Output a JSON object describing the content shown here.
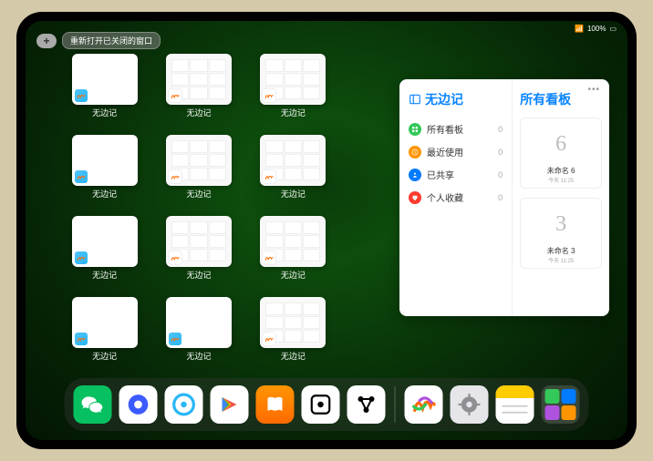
{
  "status": {
    "battery": "100%",
    "wifi": "●"
  },
  "topleft": {
    "plus": "+",
    "reopen_label": "重新打开已关闭的窗口"
  },
  "grid_label": "无边记",
  "grid": [
    {
      "kind": "blank"
    },
    {
      "kind": "cal stack"
    },
    {
      "kind": "cal stack"
    },
    {
      "kind": "blank"
    },
    {
      "kind": "cal"
    },
    {
      "kind": "cal stack"
    },
    {
      "kind": "blank"
    },
    {
      "kind": "cal"
    },
    {
      "kind": "cal stack"
    },
    {
      "kind": "blank"
    },
    {
      "kind": "blank"
    },
    {
      "kind": "cal stack"
    }
  ],
  "panel": {
    "left_title": "无边记",
    "right_title": "所有看板",
    "items": [
      {
        "icon": "grid",
        "color": "#34c759",
        "label": "所有看板",
        "count": "0"
      },
      {
        "icon": "clock",
        "color": "#ff9500",
        "label": "最近使用",
        "count": "0"
      },
      {
        "icon": "share",
        "color": "#007aff",
        "label": "已共享",
        "count": "0"
      },
      {
        "icon": "heart",
        "color": "#ff3b30",
        "label": "个人收藏",
        "count": "0"
      }
    ],
    "boards": [
      {
        "sketch": "6",
        "name": "未命名 6",
        "date": "今天 11:25"
      },
      {
        "sketch": "3",
        "name": "未命名 3",
        "date": "今天 11:25"
      }
    ]
  },
  "dock": [
    {
      "name": "wechat",
      "bg": "#07c160",
      "glyph": "wechat"
    },
    {
      "name": "quark",
      "bg": "#fff",
      "glyph": "quark"
    },
    {
      "name": "qqbrowser",
      "bg": "#fff",
      "glyph": "qqb"
    },
    {
      "name": "play",
      "bg": "#fff",
      "glyph": "play"
    },
    {
      "name": "books",
      "bg": "linear-gradient(#ff9500,#ff6a00)",
      "glyph": "books"
    },
    {
      "name": "dice",
      "bg": "#fff",
      "glyph": "dice"
    },
    {
      "name": "obsidian",
      "bg": "#fff",
      "glyph": "nodes"
    }
  ],
  "dock_recent": [
    {
      "name": "freeform",
      "bg": "#fff",
      "glyph": "freeform"
    },
    {
      "name": "settings",
      "bg": "#e5e5ea",
      "glyph": "gear"
    },
    {
      "name": "notes",
      "bg": "#fff",
      "glyph": "notes"
    }
  ]
}
